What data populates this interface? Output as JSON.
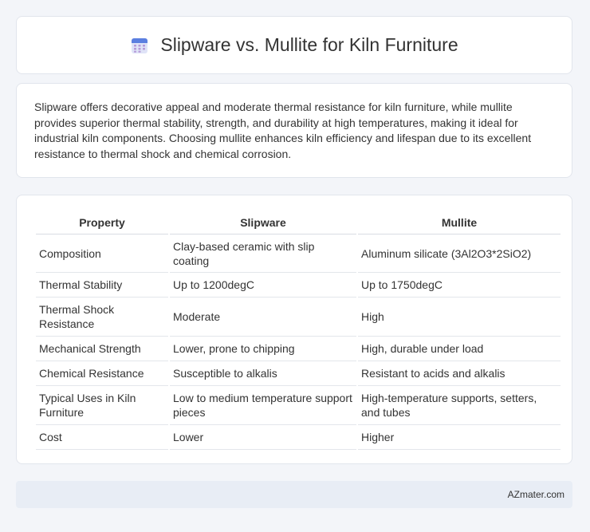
{
  "header": {
    "title": "Slipware vs. Mullite for Kiln Furniture",
    "icon": "calendar-icon"
  },
  "summary": {
    "text": "Slipware offers decorative appeal and moderate thermal resistance for kiln furniture, while mullite provides superior thermal stability, strength, and durability at high temperatures, making it ideal for industrial kiln components. Choosing mullite enhances kiln efficiency and lifespan due to its excellent resistance to thermal shock and chemical corrosion."
  },
  "table": {
    "headers": [
      "Property",
      "Slipware",
      "Mullite"
    ],
    "rows": [
      [
        "Composition",
        "Clay-based ceramic with slip coating",
        "Aluminum silicate (3Al2O3*2SiO2)"
      ],
      [
        "Thermal Stability",
        "Up to 1200degC",
        "Up to 1750degC"
      ],
      [
        "Thermal Shock Resistance",
        "Moderate",
        "High"
      ],
      [
        "Mechanical Strength",
        "Lower, prone to chipping",
        "High, durable under load"
      ],
      [
        "Chemical Resistance",
        "Susceptible to alkalis",
        "Resistant to acids and alkalis"
      ],
      [
        "Typical Uses in Kiln Furniture",
        "Low to medium temperature support pieces",
        "High-temperature supports, setters, and tubes"
      ],
      [
        "Cost",
        "Lower",
        "Higher"
      ]
    ]
  },
  "footer": {
    "brand": "AZmater.com"
  }
}
